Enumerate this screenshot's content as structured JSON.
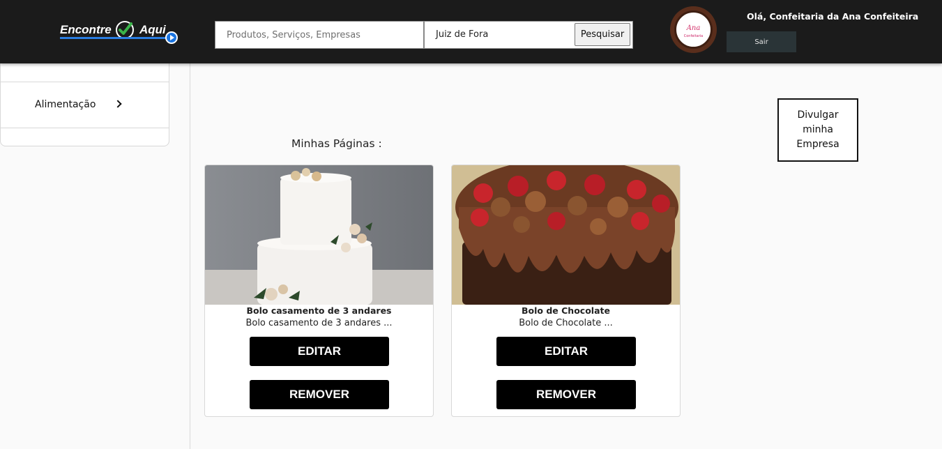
{
  "header": {
    "logo_left": "Encontre",
    "logo_right": "Aqui",
    "search_placeholder": "Produtos, Serviços, Empresas",
    "city": "Juiz de Fora",
    "search_button": "Pesquisar",
    "avatar_text": "Ana",
    "avatar_subtext": "Confeitaria",
    "greeting": "Olá, Confeitaria da Ana Confeiteira",
    "logout_button": "Sair"
  },
  "sidebar": {
    "items": [
      {
        "label": "Alimentação"
      }
    ]
  },
  "main": {
    "section_title": "Minhas Páginas :",
    "promote_button": "Divulgar minha Empresa",
    "cards": [
      {
        "title": "Bolo casamento de 3 andares",
        "description": "Bolo casamento de 3 andares ...",
        "edit_label": "EDITAR",
        "remove_label": "REMOVER"
      },
      {
        "title": "Bolo de Chocolate",
        "description": "Bolo de Chocolate ...",
        "edit_label": "EDITAR",
        "remove_label": "REMOVER"
      }
    ]
  },
  "colors": {
    "header_bg": "#1b1b1b",
    "logout_bg": "#2a3437",
    "button_bg": "#000000",
    "logo_blue": "#1a74e0",
    "logo_green": "#3ab54a"
  }
}
